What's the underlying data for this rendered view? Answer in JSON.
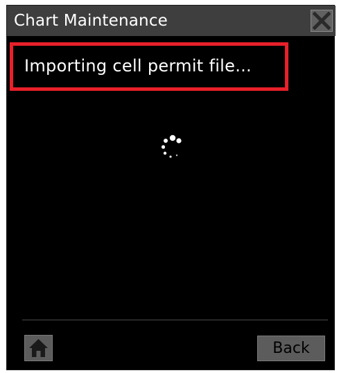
{
  "dialog": {
    "title": "Chart Maintenance",
    "close_icon": "close-icon"
  },
  "status": {
    "message": "Importing cell permit file..."
  },
  "spinner": {
    "icon": "loading-spinner-icon"
  },
  "footer": {
    "home_icon": "home-icon",
    "back_label": "Back"
  },
  "colors": {
    "background": "#000000",
    "titlebar": "#3e3e3e",
    "highlight_border": "#e8202a",
    "button": "#5c5c5c"
  }
}
